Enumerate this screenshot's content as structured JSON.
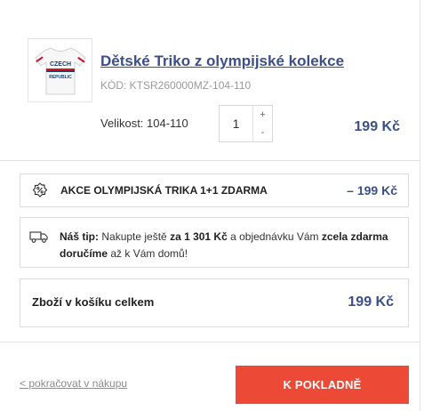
{
  "product": {
    "image_icon": "tshirt-image",
    "image_text_line1": "CZECH",
    "image_text_line2": "REPUBLIC",
    "title": "Dětské Triko z olympijské kolekce",
    "code": "KÓD: KTSR260000MZ-104-110",
    "size_label": "Velikost: 104-110",
    "quantity": "1",
    "qty_plus": "+",
    "qty_minus": "-",
    "price": "199 Kč"
  },
  "promo": {
    "icon": "percent-badge-icon",
    "text": "AKCE OLYMPIJSKÁ TRIKA 1+1 ZDARMA",
    "value": "– 199 Kč"
  },
  "tip": {
    "icon": "truck-icon",
    "label": "Náš tip:",
    "text1": " Nakupte ještě ",
    "amount": "za 1 301 Kč",
    "text2": " a objednávku Vám ",
    "highlight": "zcela zdarma doručíme",
    "text3": " až k Vám domů!"
  },
  "summary": {
    "label": "Zboží v košíku celkem",
    "value": "199 Kč"
  },
  "actions": {
    "continue": "< pokračovat v nákupu",
    "checkout": "K POKLADNĚ"
  },
  "colors": {
    "price_blue": "#3b4f8a",
    "checkout_red": "#ec4a37",
    "border": "#dcdcdc"
  }
}
